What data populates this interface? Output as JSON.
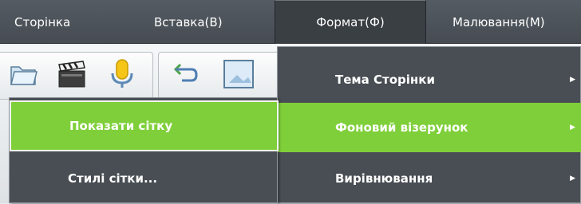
{
  "menubar": {
    "items": [
      {
        "label": "Сторінка"
      },
      {
        "label": "Вставка(В)"
      },
      {
        "label": "Формат(Ф)"
      },
      {
        "label": "Малювання(М)"
      }
    ]
  },
  "toolbar": {
    "icons": [
      "folder-icon",
      "clapperboard-icon",
      "microphone-icon",
      "undo-arrow-icon",
      "picture-frame-icon"
    ]
  },
  "format_menu": {
    "items": [
      {
        "label": "Тема Сторінки",
        "has_submenu": true
      },
      {
        "label": "Фоновий візерунок",
        "has_submenu": true,
        "active": true
      },
      {
        "label": "Вирівнювання",
        "has_submenu": true
      }
    ],
    "arrow": "▶"
  },
  "grid_submenu": {
    "items": [
      {
        "label": "Показати сітку",
        "active": true
      },
      {
        "label": "Стилі сітки..."
      }
    ]
  },
  "colors": {
    "menubar": "#4e555b",
    "menu_bg": "#484e53",
    "highlight": "#7fcf3a"
  }
}
